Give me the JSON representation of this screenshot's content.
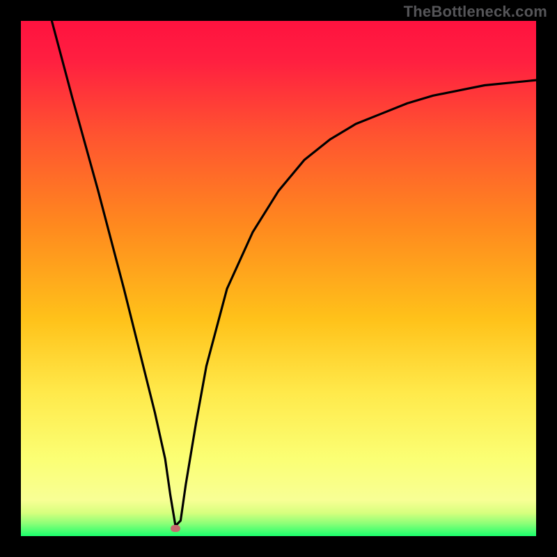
{
  "watermark": "TheBottleneck.com",
  "colors": {
    "gradient_top": "#ff1744",
    "gradient_mid1": "#ff8a1e",
    "gradient_mid2": "#ffe94a",
    "gradient_low": "#faff8a",
    "gradient_green": "#24ff70",
    "curve": "#000000",
    "frame": "#000000",
    "marker": "#c5696f"
  },
  "chart_data": {
    "type": "line",
    "title": "",
    "xlabel": "",
    "ylabel": "",
    "xlim": [
      0,
      100
    ],
    "ylim": [
      0,
      100
    ],
    "grid": false,
    "legend": false,
    "series": [
      {
        "name": "bottleneck-curve",
        "x": [
          6,
          10,
          15,
          20,
          24,
          26,
          28,
          29,
          30,
          31,
          32,
          34,
          36,
          40,
          45,
          50,
          55,
          60,
          65,
          70,
          75,
          80,
          85,
          90,
          95,
          100
        ],
        "values": [
          100,
          85,
          67,
          48,
          32,
          24,
          15,
          8,
          2,
          3,
          10,
          22,
          33,
          48,
          59,
          67,
          73,
          77,
          80,
          82,
          84,
          85.5,
          86.5,
          87.5,
          88,
          88.5
        ]
      }
    ],
    "marker": {
      "x": 30,
      "y": 1.5
    }
  }
}
